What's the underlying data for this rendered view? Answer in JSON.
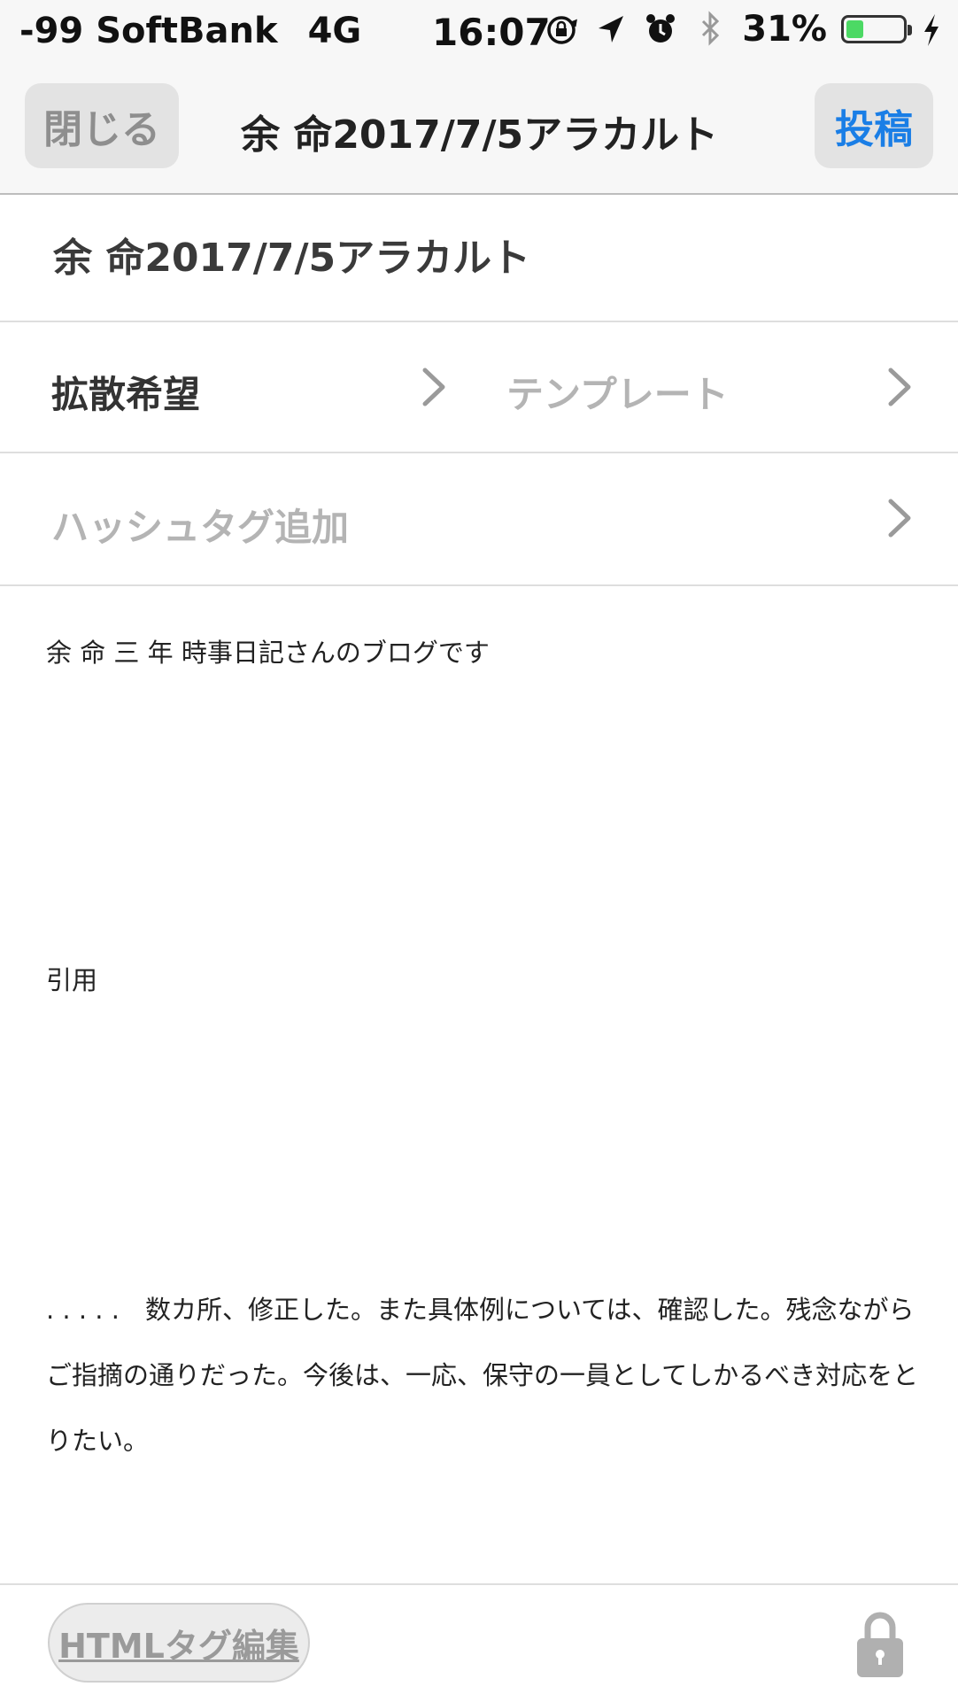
{
  "status_bar": {
    "carrier": "-99 SoftBank",
    "network": "4G",
    "time": "16:07",
    "battery_percent_text": "31%",
    "battery_level": 0.31,
    "colors": {
      "battery_fill": "#4cd964"
    },
    "icons": [
      "orientation-lock-icon",
      "location-arrow-icon",
      "alarm-icon",
      "bluetooth-icon",
      "charging-bolt-icon"
    ]
  },
  "nav": {
    "close_label": "閉じる",
    "title": "余 命2017/7/5アラカルト",
    "post_label": "投稿",
    "colors": {
      "post": "#1a7ee6"
    }
  },
  "editor": {
    "title_value": "余 命2017/7/5アラカルト",
    "spread_label": "拡散希望",
    "template_placeholder": "テンプレート",
    "hashtag_placeholder": "ハッシュタグ追加",
    "body": {
      "p1": "余 命 三 年 時事日記さんのブログです",
      "p2": "引用",
      "p3": ". . . . .　数カ所、修正した。また具体例については、確認した。残念ながらご指摘の通りだった。今後は、一応、保守の一員としてしかるべき対応をとりたい。"
    }
  },
  "toolbar": {
    "html_edit_label": "HTMLタグ編集",
    "lock_icon": "lock-icon"
  }
}
